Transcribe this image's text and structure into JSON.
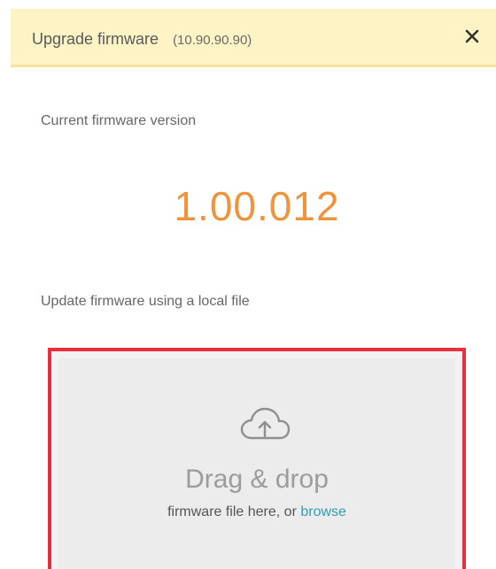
{
  "header": {
    "title": "Upgrade firmware",
    "ip": "(10.90.90.90)",
    "close_icon": "close-icon"
  },
  "current": {
    "label": "Current firmware version",
    "version": "1.00.012"
  },
  "update": {
    "label": "Update firmware using a local file"
  },
  "dropzone": {
    "icon": "cloud-upload-icon",
    "title": "Drag & drop",
    "subtitle_prefix": "firmware file here, or ",
    "browse_label": "browse"
  },
  "colors": {
    "header_bg": "#fdf3c4",
    "version": "#f0933a",
    "highlight_border": "#e8303a",
    "link": "#2aa0b6"
  }
}
